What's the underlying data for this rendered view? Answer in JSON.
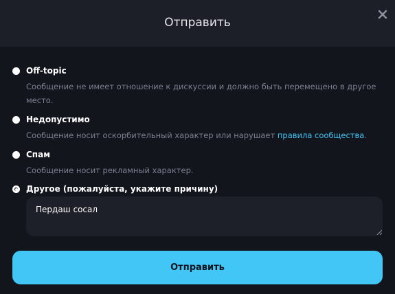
{
  "header": {
    "title": "Отправить",
    "close_icon": "close-icon"
  },
  "options": [
    {
      "title": "Off-topic",
      "description": "Сообщение не имеет отношение к дискуссии и должно быть перемещено в другое место.",
      "checked": false
    },
    {
      "title": "Недопустимо",
      "description": "Сообщение носит оскорбительный характер или нарушает ",
      "link": "правила сообщества",
      "description_end": ".",
      "checked": false
    },
    {
      "title": "Спам",
      "description": "Сообщение носит рекламный характер.",
      "checked": false
    },
    {
      "title": "Другое (пожалуйста, укажите причину)",
      "checked": true
    }
  ],
  "reason": {
    "value": "Пердаш сосал"
  },
  "submit": {
    "label": "Отправить"
  },
  "colors": {
    "background": "#13151d",
    "header": "#1c1e28",
    "accent": "#41c6f5",
    "muted_text": "#7c8090"
  }
}
